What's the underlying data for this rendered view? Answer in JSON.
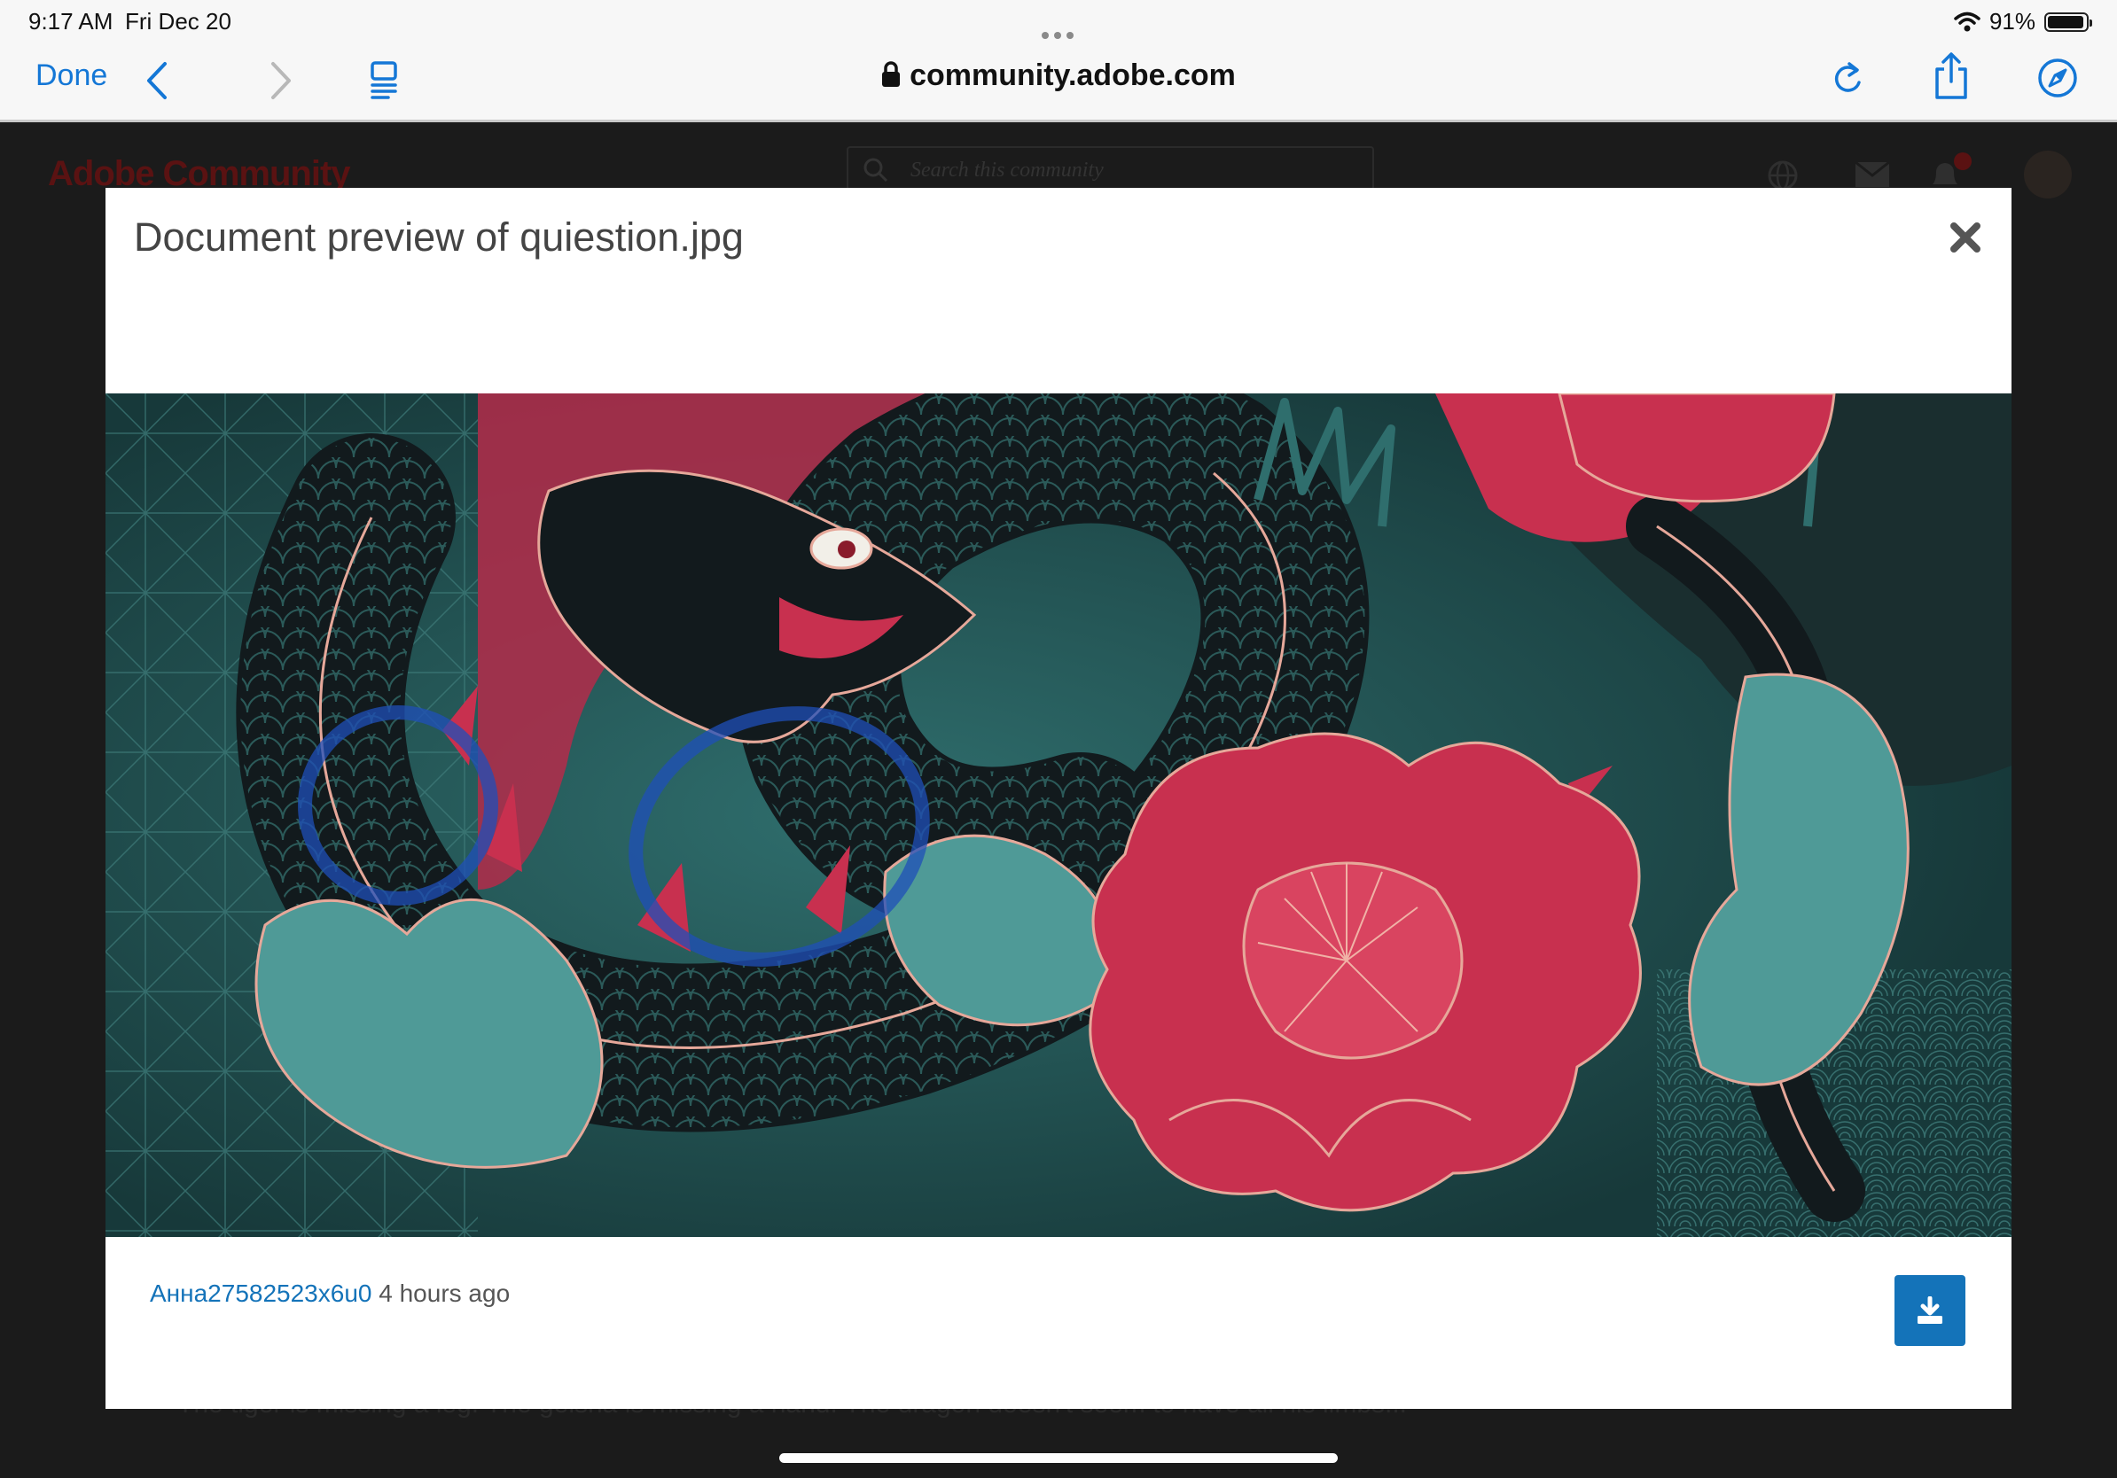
{
  "status_bar": {
    "time": "9:17 AM",
    "date": "Fri Dec 20",
    "battery": "91%"
  },
  "browser": {
    "done_label": "Done",
    "address": "community.adobe.com",
    "icons": [
      "back-icon",
      "forward-icon",
      "reader-icon",
      "reload-icon",
      "share-icon",
      "compass-icon",
      "lock-icon",
      "wifi-icon",
      "battery-icon"
    ]
  },
  "background_page": {
    "logo": "Adobe Community",
    "search_placeholder": "Search this community",
    "footer_text": "The tiger is missing a leg. The geisha is missing a hand. The dragon doesn't seem to have all his limbs..."
  },
  "modal": {
    "title": "Document preview of quiestion.jpg",
    "uploader": "Анна27582523x6u0",
    "time_ago": "4 hours ago",
    "colors": {
      "accent": "#1473b9",
      "illustration_teal": "#2f6e6d",
      "illustration_pink": "#c8304f"
    }
  }
}
